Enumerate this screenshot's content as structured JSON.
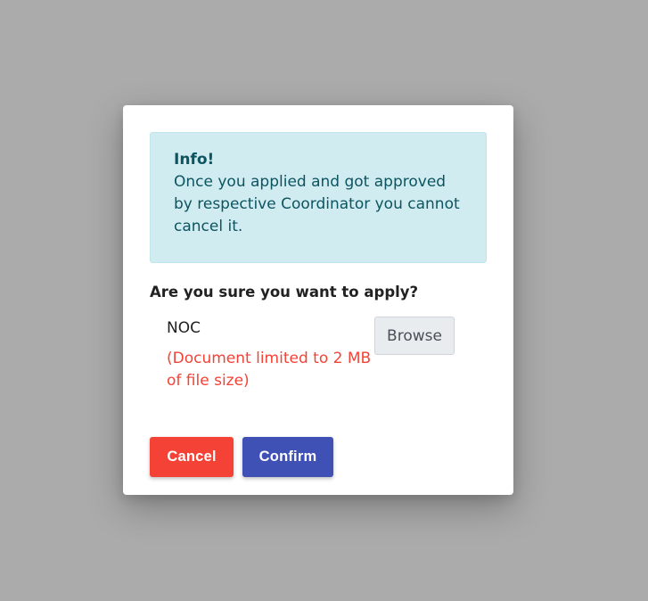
{
  "dialog": {
    "info": {
      "title": "Info!",
      "message": "Once you applied and got approved by respective Coordinator you cannot cancel it."
    },
    "question": "Are you sure you want to apply?",
    "document": {
      "label": "NOC",
      "note": "(Document limited to 2 MB of file size)",
      "browse_label": "Browse"
    },
    "buttons": {
      "cancel_label": "Cancel",
      "confirm_label": "Confirm"
    }
  },
  "colors": {
    "overlay": "#ababab",
    "info_bg": "#d1ecf1",
    "info_text": "#0c5460",
    "note_text": "#f44336",
    "cancel_bg": "#f44336",
    "confirm_bg": "#3f51b5"
  }
}
